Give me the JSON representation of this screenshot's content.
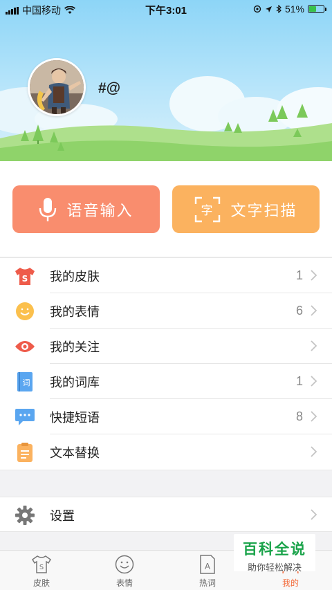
{
  "status_bar": {
    "carrier": "中国移动",
    "time": "下午3:01",
    "battery_percent": "51%",
    "battery_level": 0.51
  },
  "profile": {
    "username": "#@",
    "avatar_icon": "avatar-illustration"
  },
  "actions": {
    "voice_label": "语音输入",
    "scan_label": "文字扫描",
    "voice_color": "#f98d6e",
    "scan_color": "#fbb25f"
  },
  "menu": {
    "items": [
      {
        "label": "我的皮肤",
        "count": "1",
        "icon": "skin-shirt-icon"
      },
      {
        "label": "我的表情",
        "count": "6",
        "icon": "emoji-icon"
      },
      {
        "label": "我的关注",
        "count": "",
        "icon": "eye-icon"
      },
      {
        "label": "我的词库",
        "count": "1",
        "icon": "dictionary-icon"
      },
      {
        "label": "快捷短语",
        "count": "8",
        "icon": "chat-bubble-icon"
      },
      {
        "label": "文本替换",
        "count": "",
        "icon": "clipboard-icon"
      }
    ],
    "settings_label": "设置"
  },
  "watermark": {
    "title": "百科全说",
    "subtitle": "助你轻松解决"
  },
  "tabbar": {
    "tabs": [
      {
        "label": "皮肤",
        "icon": "shirt-tab-icon",
        "active": false
      },
      {
        "label": "表情",
        "icon": "smile-tab-icon",
        "active": false
      },
      {
        "label": "热词",
        "icon": "hotword-tab-icon",
        "active": false
      },
      {
        "label": "我的",
        "icon": "me-tab-icon",
        "active": true
      }
    ],
    "active_color": "#f36a3a"
  }
}
